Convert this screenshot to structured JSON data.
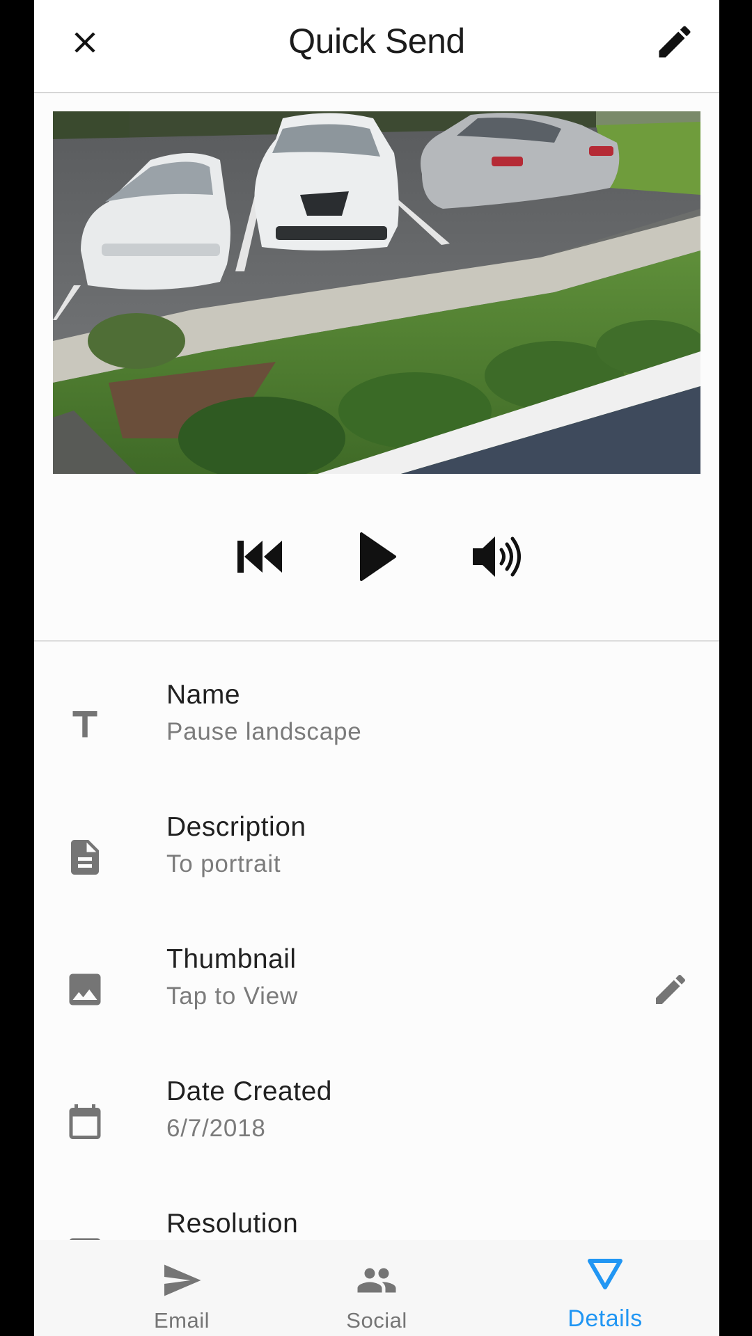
{
  "header": {
    "title": "Quick Send"
  },
  "player": {
    "controls": [
      "skip-back-icon",
      "play-icon",
      "volume-icon"
    ]
  },
  "details": [
    {
      "icon": "text-icon",
      "label": "Name",
      "value": "Pause landscape"
    },
    {
      "icon": "document-icon",
      "label": "Description",
      "value": "To portrait"
    },
    {
      "icon": "image-icon",
      "label": "Thumbnail",
      "value": "Tap to View",
      "action": "pencil-icon"
    },
    {
      "icon": "calendar-icon",
      "label": "Date Created",
      "value": "6/7/2018"
    },
    {
      "icon": "checkbox-icon",
      "label": "Resolution",
      "value": ""
    }
  ],
  "bottom_nav": {
    "items": [
      {
        "icon": "send-icon",
        "label": "Email"
      },
      {
        "icon": "people-icon",
        "label": "Social"
      },
      {
        "icon": "triangle-icon",
        "label": "Details",
        "active": true
      }
    ]
  },
  "colors": {
    "accent": "#2196f3",
    "icon_gray": "#757575",
    "text_primary": "#212121",
    "text_secondary": "#7b7b7b"
  }
}
